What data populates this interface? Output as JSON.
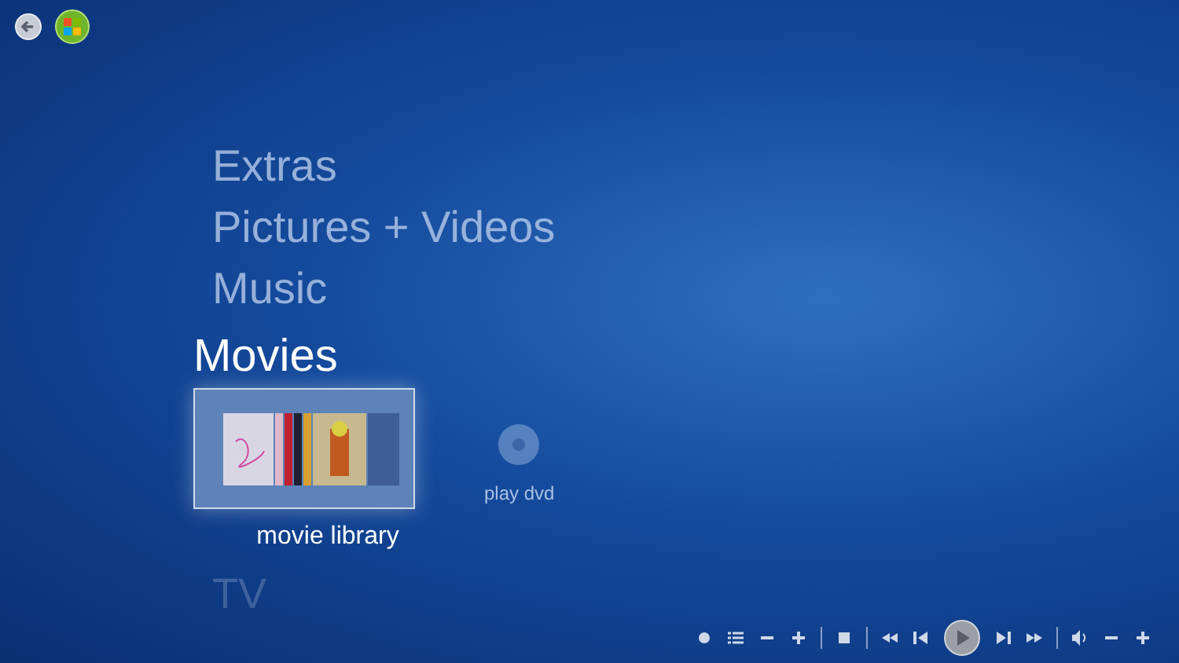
{
  "menu": [
    {
      "label": "Extras",
      "selected": false
    },
    {
      "label": "Pictures + Videos",
      "selected": false
    },
    {
      "label": "Music",
      "selected": false
    },
    {
      "label": "Movies",
      "selected": true,
      "tiles": [
        {
          "kind": "library",
          "label": "movie library",
          "selected": true
        },
        {
          "kind": "disc",
          "label": "play dvd",
          "selected": false
        }
      ]
    },
    {
      "label": "TV",
      "selected": false
    }
  ]
}
